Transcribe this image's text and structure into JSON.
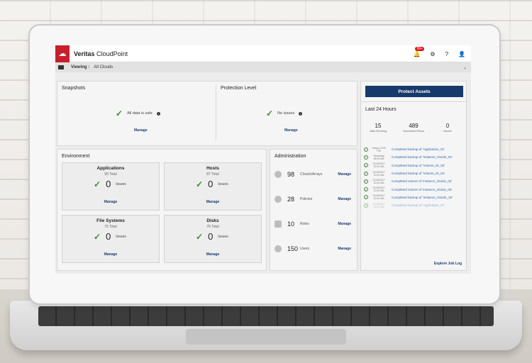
{
  "app": {
    "brand_bold": "Veritas",
    "brand_light": "CloudPoint",
    "notification_badge": "99+",
    "help_label": "?",
    "viewing_label": "Viewing :",
    "viewing_value": "All Clouds"
  },
  "snapshots": {
    "title": "Snapshots",
    "status": "All data is safe",
    "manage": "Manage"
  },
  "protection": {
    "title": "Protection Level",
    "status": "No issues",
    "manage": "Manage"
  },
  "environment": {
    "title": "Environment",
    "cards": [
      {
        "title": "Applications",
        "total": "99 Total",
        "count": "0",
        "issues": "Issues",
        "manage": "Manage"
      },
      {
        "title": "Hosts",
        "total": "87 Total",
        "count": "0",
        "issues": "Issues",
        "manage": "Manage"
      },
      {
        "title": "File Systems",
        "total": "75 Total",
        "count": "0",
        "issues": "Issues",
        "manage": "Manage"
      },
      {
        "title": "Disks",
        "total": "76 Total",
        "count": "0",
        "issues": "Issues",
        "manage": "Manage"
      }
    ]
  },
  "administration": {
    "title": "Administration",
    "rows": [
      {
        "icon": "cloud-icon",
        "count": "98",
        "label": "Clouds/Arrays",
        "manage": "Manage"
      },
      {
        "icon": "policy-icon",
        "count": "28",
        "label": "Policies",
        "manage": "Manage"
      },
      {
        "icon": "briefcase-icon",
        "count": "10",
        "label": "Roles",
        "manage": "Manage"
      },
      {
        "icon": "user-icon",
        "count": "150",
        "label": "Users",
        "manage": "Manage"
      }
    ]
  },
  "right": {
    "protect_button": "Protect Assets",
    "last24_title": "Last 24 Hours",
    "stats": [
      {
        "value": "15",
        "label": "Jobs Running"
      },
      {
        "value": "489",
        "label": "Successful Runs"
      },
      {
        "value": "0",
        "label": "Issues"
      }
    ],
    "jobs": [
      {
        "time": "Today 12:00 PM",
        "text": "Completed backup of 'Application_01'"
      },
      {
        "time": "Yesterday 08:23 AM",
        "text": "Completed backup of 'Instance_Oracle_02'"
      },
      {
        "time": "11/16/2017 10:41 AM",
        "text": "Completed backup of 'Volume_ID_03'"
      },
      {
        "time": "11/16/2017 10:41 AM",
        "text": "Completed backup of 'Volume_ID_04'"
      },
      {
        "time": "11/16/2017 10:41 AM",
        "text": "Completed restore of 'Instance_Oracle_02'"
      },
      {
        "time": "11/16/2017 10:41 AM",
        "text": "Completed restore of 'Instance_Oracle_03'"
      },
      {
        "time": "11/16/2017 10:41 AM",
        "text": "Completed backup of 'Instance_Oracle_19'"
      },
      {
        "time": "11/16/2017 10:41 AM",
        "text": "Completed backup of 'Application_07'"
      }
    ],
    "explore": "Explore Job Log"
  },
  "colors": {
    "brand_red": "#c8202a",
    "navy": "#163a6b",
    "success_green": "#3a8a2e",
    "link_blue": "#2a66b0"
  }
}
